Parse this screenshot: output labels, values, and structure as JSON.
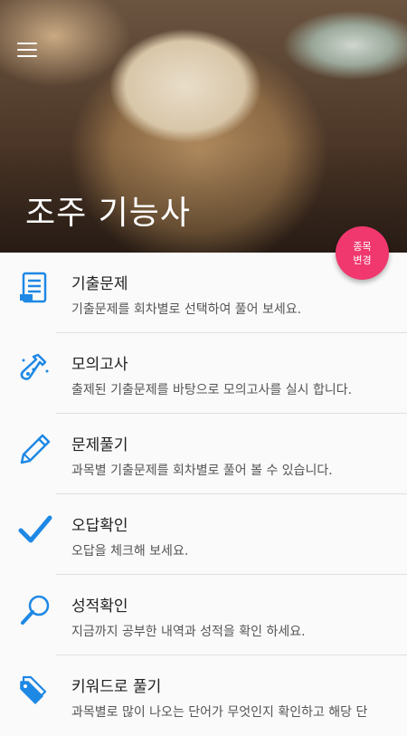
{
  "header": {
    "title": "조주 기능사",
    "menu_icon": "hamburger-menu-icon"
  },
  "fab": {
    "line1": "종목",
    "line2": "변경",
    "color": "#f0386e"
  },
  "accent_color": "#1e88e5",
  "menu_items": [
    {
      "label": "기출문제",
      "desc": "기출문제를 회차별로 선택하여 풀어 보세요.",
      "icon": "document-list-icon"
    },
    {
      "label": "모의고사",
      "desc": "출제된 기출문제를 바탕으로 모의고사를 실시 합니다.",
      "icon": "flask-icon"
    },
    {
      "label": "문제풀기",
      "desc": "과목별 기출문제를 회차별로 풀어 볼 수 있습니다.",
      "icon": "pencil-icon"
    },
    {
      "label": "오답확인",
      "desc": "오답을 체크해 보세요.",
      "icon": "checkmark-icon"
    },
    {
      "label": "성적확인",
      "desc": "지금까지 공부한 내역과 성적을 확인 하세요.",
      "icon": "magnifier-icon"
    },
    {
      "label": "키워드로 풀기",
      "desc": "과목별로 많이 나오는 단어가 무엇인지 확인하고 해당 단",
      "icon": "tag-icon"
    }
  ]
}
